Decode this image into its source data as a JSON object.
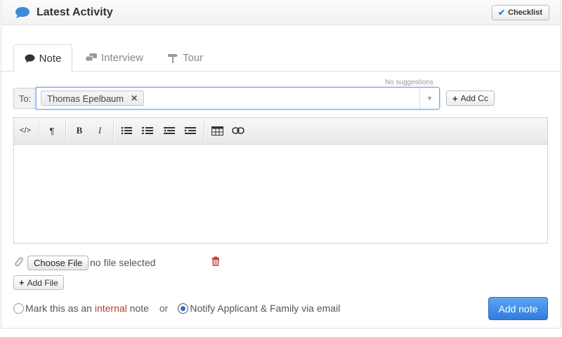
{
  "header": {
    "title": "Latest Activity",
    "checklist_label": "Checklist"
  },
  "tabs": [
    {
      "label": "Note",
      "icon": "speech-bubble-icon",
      "active": true
    },
    {
      "label": "Interview",
      "icon": "chat-bubbles-icon",
      "active": false
    },
    {
      "label": "Tour",
      "icon": "signpost-icon",
      "active": false
    }
  ],
  "recipients": {
    "no_suggestions": "No suggestions",
    "to_label": "To:",
    "selected": [
      "Thomas Epelbaum"
    ],
    "add_cc_label": "Add Cc"
  },
  "toolbar": {
    "buttons": [
      {
        "name": "html-source-icon",
        "glyph": "</>"
      },
      {
        "name": "paragraph-icon",
        "glyph": "¶"
      },
      {
        "name": "bold-icon",
        "glyph": "B"
      },
      {
        "name": "italic-icon",
        "glyph": "I"
      },
      {
        "name": "bullet-list-icon",
        "glyph": "☰"
      },
      {
        "name": "numbered-list-icon",
        "glyph": "☰"
      },
      {
        "name": "outdent-icon",
        "glyph": "⇤"
      },
      {
        "name": "indent-icon",
        "glyph": "⇥"
      },
      {
        "name": "table-icon",
        "glyph": "▦"
      },
      {
        "name": "link-icon",
        "glyph": "⊖"
      }
    ]
  },
  "editor": {
    "content": ""
  },
  "attachments": {
    "choose_file_label": "Choose File",
    "file_status": "no file selected",
    "add_file_label": "Add File"
  },
  "options": {
    "internal_prefix": "Mark this as an",
    "internal_word": "internal",
    "internal_suffix": "note",
    "or": "or",
    "notify_label": "Notify Applicant & Family via email",
    "selected": "notify"
  },
  "submit": {
    "label": "Add note"
  },
  "colors": {
    "accent_blue": "#2f7ddb",
    "internal_red": "#c0392b",
    "trash_red": "#c0392b"
  }
}
